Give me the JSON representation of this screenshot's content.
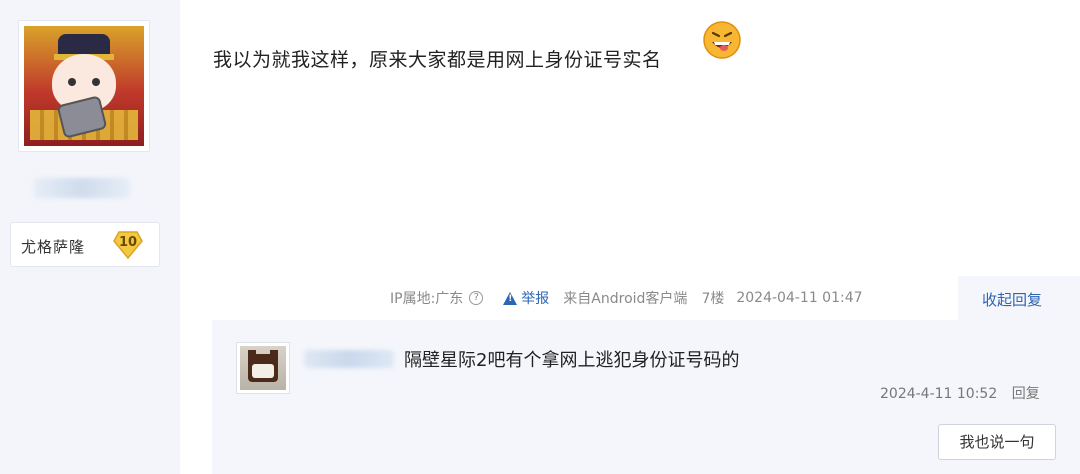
{
  "post": {
    "text": "我以为就我这样，原来大家都是用网上身份证号实名",
    "emoji_icon": "grinning-tongue-emoji"
  },
  "author": {
    "badge_name": "尤格萨隆",
    "level": "10"
  },
  "meta": {
    "ip_location": "IP属地:广东",
    "help_glyph": "?",
    "report_label": "举报",
    "source": "来自Android客户端",
    "floor": "7楼",
    "timestamp": "2024-04-11 01:47",
    "collapse_label": "收起回复"
  },
  "reply": {
    "text": "隔壁星际2吧有个拿网上逃犯身份证号码的",
    "timestamp": "2024-4-11 10:52",
    "reply_label": "回复",
    "say_button_label": "我也说一句"
  },
  "colors": {
    "link_blue": "#2d64b3",
    "panel_bg": "#f4f6fb",
    "badge_gold": "#f5c842"
  }
}
